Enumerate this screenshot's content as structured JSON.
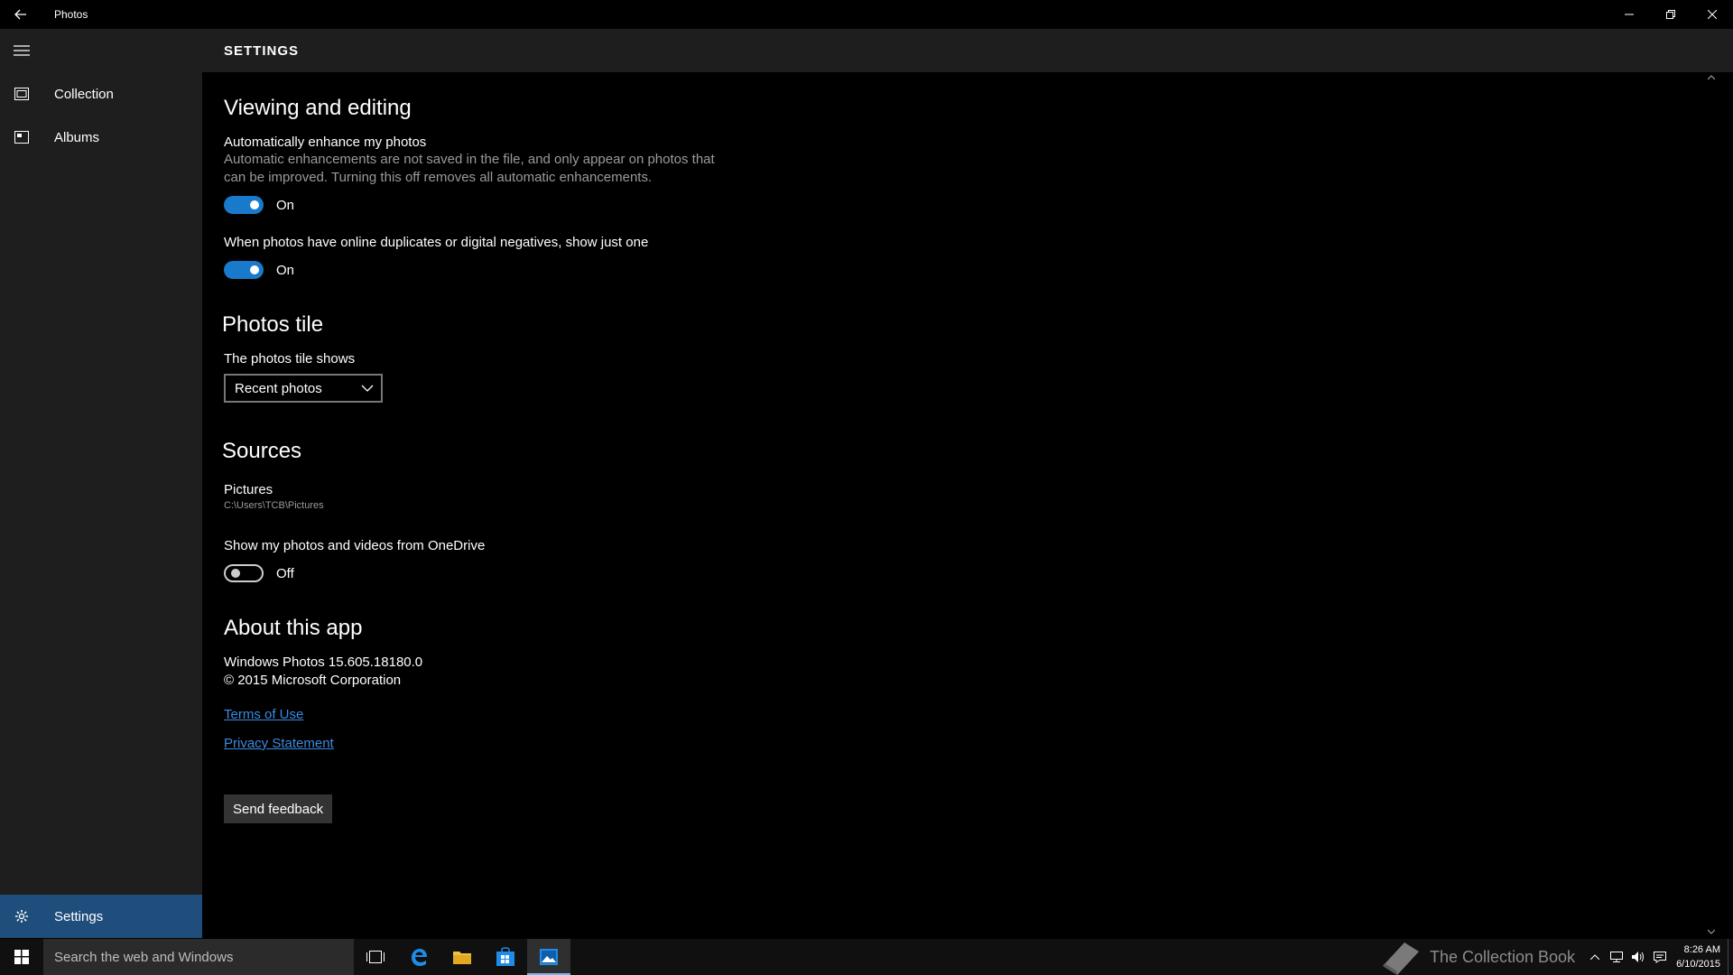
{
  "window": {
    "title": "Photos"
  },
  "nav": {
    "items": [
      {
        "label": "Collection"
      },
      {
        "label": "Albums"
      }
    ],
    "settings_label": "Settings"
  },
  "header": {
    "title": "SETTINGS"
  },
  "viewing": {
    "title": "Viewing and editing",
    "enhance_label": "Automatically enhance my photos",
    "enhance_desc": "Automatic enhancements are not saved in the file, and only appear on photos that can be improved. Turning this off removes all automatic enhancements.",
    "enhance_state": "On",
    "duplicates_label": "When photos have online duplicates or digital negatives, show just one",
    "duplicates_state": "On"
  },
  "tile": {
    "title": "Photos tile",
    "label": "The photos tile shows",
    "selected": "Recent photos"
  },
  "sources": {
    "title": "Sources",
    "folder_name": "Pictures",
    "folder_path": "C:\\Users\\TCB\\Pictures",
    "onedrive_label": "Show my photos and videos from OneDrive",
    "onedrive_state": "Off"
  },
  "about": {
    "title": "About this app",
    "version": "Windows Photos 15.605.18180.0",
    "copyright": "© 2015 Microsoft Corporation",
    "terms": "Terms of Use",
    "privacy": "Privacy Statement",
    "feedback": "Send feedback"
  },
  "taskbar": {
    "search_placeholder": "Search the web and Windows",
    "watermark": "The Collection Book",
    "time": "8:26 AM",
    "date": "6/10/2015"
  },
  "colors": {
    "accent": "#1979ca",
    "nav_selected": "#1f4e7c",
    "link": "#3a8be0"
  }
}
